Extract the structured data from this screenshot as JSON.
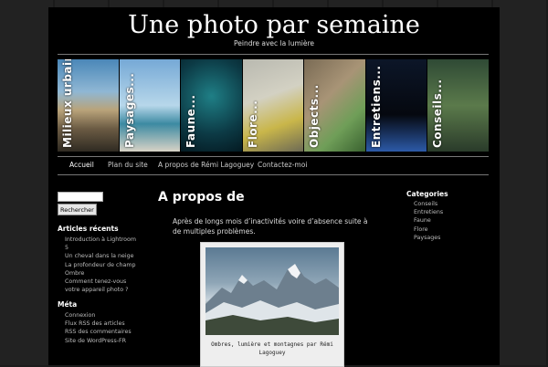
{
  "site": {
    "title": "Une photo par semaine",
    "description": "Peindre avec la lumière"
  },
  "banner": {
    "tiles": [
      {
        "label": "Milieux urbains...",
        "icon": "city-street-photo"
      },
      {
        "label": "Paysages...",
        "icon": "beach-landscape-photo"
      },
      {
        "label": "Faune...",
        "icon": "fish-underwater-photo"
      },
      {
        "label": "Flore...",
        "icon": "flower-photo"
      },
      {
        "label": "Objects...",
        "icon": "object-photo"
      },
      {
        "label": "Entretiens...",
        "icon": "night-photo"
      },
      {
        "label": "Conseils...",
        "icon": "nature-photo"
      }
    ]
  },
  "nav": {
    "items": [
      "Accueil",
      "Plan du site",
      "A propos de Rémi Lagoguey",
      "Contactez-moi"
    ]
  },
  "search": {
    "value": "",
    "button_label": "Rechercher"
  },
  "recent": {
    "title": "Articles récents",
    "items": [
      "Introduction à Lightroom",
      "5",
      "Un cheval dans la neige",
      "La profondeur de champ",
      "Ombre",
      "Comment tenez-vous",
      "votre appareil photo ?"
    ]
  },
  "meta": {
    "title": "Méta",
    "items": [
      "Connexion",
      "Flux RSS des articles",
      "RSS des commentaires",
      "Site de WordPress-FR"
    ]
  },
  "post": {
    "title": "A propos de",
    "text": "Après de longs mois d’inactivités voire d’absence suite à de multiples problèmes.",
    "caption": "Ombres, lumière et montagnes par Rémi Lagoguey"
  },
  "categories": {
    "title": "Categories",
    "items": [
      "Conseils",
      "Entretiens",
      "Faune",
      "Flore",
      "Paysages"
    ]
  },
  "colors": {
    "background": "#1c1c1c",
    "page": "#000000",
    "text": "#cccccc",
    "heading": "#ffffff"
  }
}
